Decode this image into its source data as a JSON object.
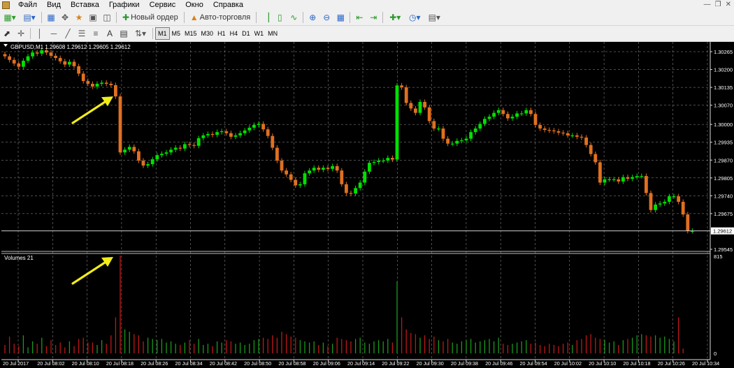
{
  "menu": [
    "Файл",
    "Вид",
    "Вставка",
    "Графики",
    "Сервис",
    "Окно",
    "Справка"
  ],
  "toolbar": {
    "new_order": "Новый ордер",
    "auto_trading": "Авто-торговля",
    "timeframes": [
      "M1",
      "M5",
      "M15",
      "M30",
      "H1",
      "H4",
      "D1",
      "W1",
      "MN"
    ],
    "active_timeframe": "M1"
  },
  "chart": {
    "header": "GBPUSD,M1  1.29608 1.29612 1.29605 1.29612",
    "price_ticks": [
      "1.30265",
      "1.30200",
      "1.30135",
      "1.30070",
      "1.30000",
      "1.29935",
      "1.29870",
      "1.29805",
      "1.29740",
      "1.29675",
      "1.29545"
    ],
    "current_price": "1.29612",
    "volume_label": "Volumes 21",
    "volume_max_label": "815",
    "volume_min_label": "0",
    "time_ticks": [
      "20 Jul 2017",
      "20 Jul 08:02",
      "20 Jul 08:10",
      "20 Jul 08:18",
      "20 Jul 08:26",
      "20 Jul 08:34",
      "20 Jul 08:42",
      "20 Jul 08:50",
      "20 Jul 08:58",
      "20 Jul 09:06",
      "20 Jul 09:14",
      "20 Jul 09:22",
      "20 Jul 09:30",
      "20 Jul 09:38",
      "20 Jul 09:46",
      "20 Jul 09:54",
      "20 Jul 10:02",
      "20 Jul 10:10",
      "20 Jul 10:18",
      "20 Jul 10:26",
      "20 Jul 10:34"
    ],
    "colors": {
      "bull": "#00e000",
      "bear": "#e07020",
      "bull_vol": "#1a9a1a",
      "bear_vol": "#c01818",
      "arrow": "#f2ec18",
      "grid": "#9a9a9a"
    }
  },
  "chart_data": {
    "type": "candlestick",
    "symbol": "GBPUSD",
    "timeframe": "M1",
    "closes": [
      1.30248,
      1.30235,
      1.30222,
      1.3021,
      1.30232,
      1.30248,
      1.30262,
      1.30258,
      1.3027,
      1.30262,
      1.3025,
      1.30242,
      1.3023,
      1.30218,
      1.30228,
      1.30212,
      1.30185,
      1.30158,
      1.30148,
      1.30138,
      1.30148,
      1.30152,
      1.30148,
      1.30143,
      1.30102,
      1.29898,
      1.29908,
      1.29918,
      1.29902,
      1.29868,
      1.2985,
      1.29855,
      1.29873,
      1.29888,
      1.29893,
      1.29898,
      1.29908,
      1.29915,
      1.29912,
      1.29928,
      1.29925,
      1.29922,
      1.2995,
      1.2996,
      1.29965,
      1.29962,
      1.29972,
      1.29975,
      1.29968,
      1.29955,
      1.2996,
      1.29968,
      1.29978,
      1.29988,
      1.29998,
      1.30002,
      1.29982,
      1.29958,
      1.29915,
      1.29868,
      1.29832,
      1.29818,
      1.29798,
      1.29778,
      1.29782,
      1.29822,
      1.29832,
      1.29842,
      1.29835,
      1.29842,
      1.29838,
      1.29848,
      1.29832,
      1.29782,
      1.2975,
      1.29748,
      1.29768,
      1.29788,
      1.29828,
      1.2986,
      1.29863,
      1.29868,
      1.29868,
      1.29878,
      1.29872,
      1.30142,
      1.30135,
      1.30078,
      1.30058,
      1.30042,
      1.30082,
      1.30062,
      1.30012,
      1.29985,
      1.29985,
      1.29948,
      1.2993,
      1.2993,
      1.2994,
      1.29942,
      1.29948,
      1.29972,
      1.29985,
      1.30002,
      1.3002,
      1.30028,
      1.30042,
      1.30052,
      1.30038,
      1.30022,
      1.30028,
      1.3004,
      1.3004,
      1.30052,
      1.30038,
      1.29998,
      1.29985,
      1.2998,
      1.29978,
      1.29975,
      1.2997,
      1.29968,
      1.2996,
      1.2996,
      1.29955,
      1.29952,
      1.29925,
      1.29892,
      1.29862,
      1.29788,
      1.298,
      1.298,
      1.298,
      1.29792,
      1.29808,
      1.29802,
      1.29808,
      1.29812,
      1.29812,
      1.2975,
      1.29688,
      1.29708,
      1.29712,
      1.29718,
      1.29738,
      1.29738,
      1.29718,
      1.29672,
      1.29612,
      1.29612
    ],
    "volumes": [
      70,
      140,
      80,
      60,
      150,
      50,
      100,
      80,
      130,
      60,
      110,
      70,
      90,
      50,
      100,
      60,
      120,
      130,
      90,
      90,
      70,
      110,
      80,
      150,
      300,
      815,
      200,
      180,
      160,
      150,
      100,
      130,
      120,
      110,
      120,
      90,
      100,
      80,
      70,
      90,
      110,
      80,
      120,
      70,
      80,
      60,
      100,
      90,
      110,
      100,
      80,
      90,
      70,
      80,
      110,
      120,
      130,
      120,
      150,
      130,
      180,
      160,
      140,
      130,
      110,
      100,
      90,
      100,
      70,
      90,
      60,
      80,
      130,
      120,
      110,
      100,
      120,
      130,
      90,
      80,
      100,
      110,
      100,
      120,
      90,
      600,
      300,
      200,
      170,
      160,
      130,
      150,
      120,
      140,
      110,
      100,
      120,
      90,
      80,
      100,
      110,
      120,
      90,
      100,
      110,
      120,
      100,
      130,
      80,
      70,
      80,
      90,
      100,
      110,
      80,
      90,
      70,
      60,
      80,
      70,
      60,
      80,
      90,
      70,
      110,
      120,
      150,
      160,
      130,
      120,
      110,
      90,
      100,
      70,
      110,
      120,
      130,
      150,
      160,
      150,
      140,
      150,
      130,
      140,
      120,
      100,
      300,
      40
    ],
    "y_range": [
      1.29545,
      1.30265
    ],
    "volume_range": [
      0,
      815
    ],
    "annotations": [
      {
        "type": "arrow",
        "target_bar": 25,
        "pane": "price"
      },
      {
        "type": "arrow",
        "target_bar": 25,
        "pane": "volume"
      }
    ]
  }
}
